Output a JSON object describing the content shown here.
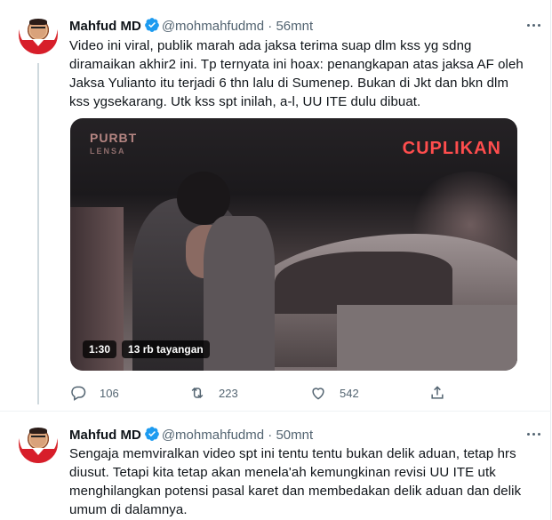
{
  "tweets": [
    {
      "author_name": "Mahfud MD",
      "handle": "@mohmahfudmd",
      "separator": "·",
      "time": "56mnt",
      "text_lines": [
        "Video ini viral, publik marah ada jaksa terima suap dlm kss yg sdng",
        "diramaikan akhir2 ini. Tp ternyata ini hoax: penangkapan atas jaksa AF oleh",
        "Jaksa Yulianto itu terjadi 6 thn lalu di Sumenep. Bukan di Jkt dan bkn dlm",
        "kss ygsekarang. Utk kss spt inilah, a-l, UU ITE dulu dibuat."
      ],
      "video": {
        "watermark_logo": "PURBT",
        "watermark_sub": "LENSA",
        "overlay_label": "CUPLIKAN",
        "duration": "1:30",
        "views": "13 rb tayangan"
      },
      "actions": {
        "replies": "106",
        "retweets": "223",
        "likes": "542"
      }
    },
    {
      "author_name": "Mahfud MD",
      "handle": "@mohmahfudmd",
      "separator": "·",
      "time": "50mnt",
      "text_lines": [
        "Sengaja memviralkan video spt ini tentu tentu bukan delik aduan, tetap hrs",
        "diusut. Tetapi kita tetap akan menela'ah kemungkinan revisi UU ITE utk",
        "menghilangkan potensi pasal karet dan membedakan delik aduan dan delik",
        "umum di dalamnya."
      ]
    }
  ],
  "colors": {
    "verified": "#1d9bf0",
    "secondary_text": "#536471",
    "overlay_red": "#ff4d4d"
  },
  "icons": [
    "verified-badge-icon",
    "more-options-icon",
    "reply-icon",
    "retweet-icon",
    "like-icon",
    "share-icon"
  ]
}
